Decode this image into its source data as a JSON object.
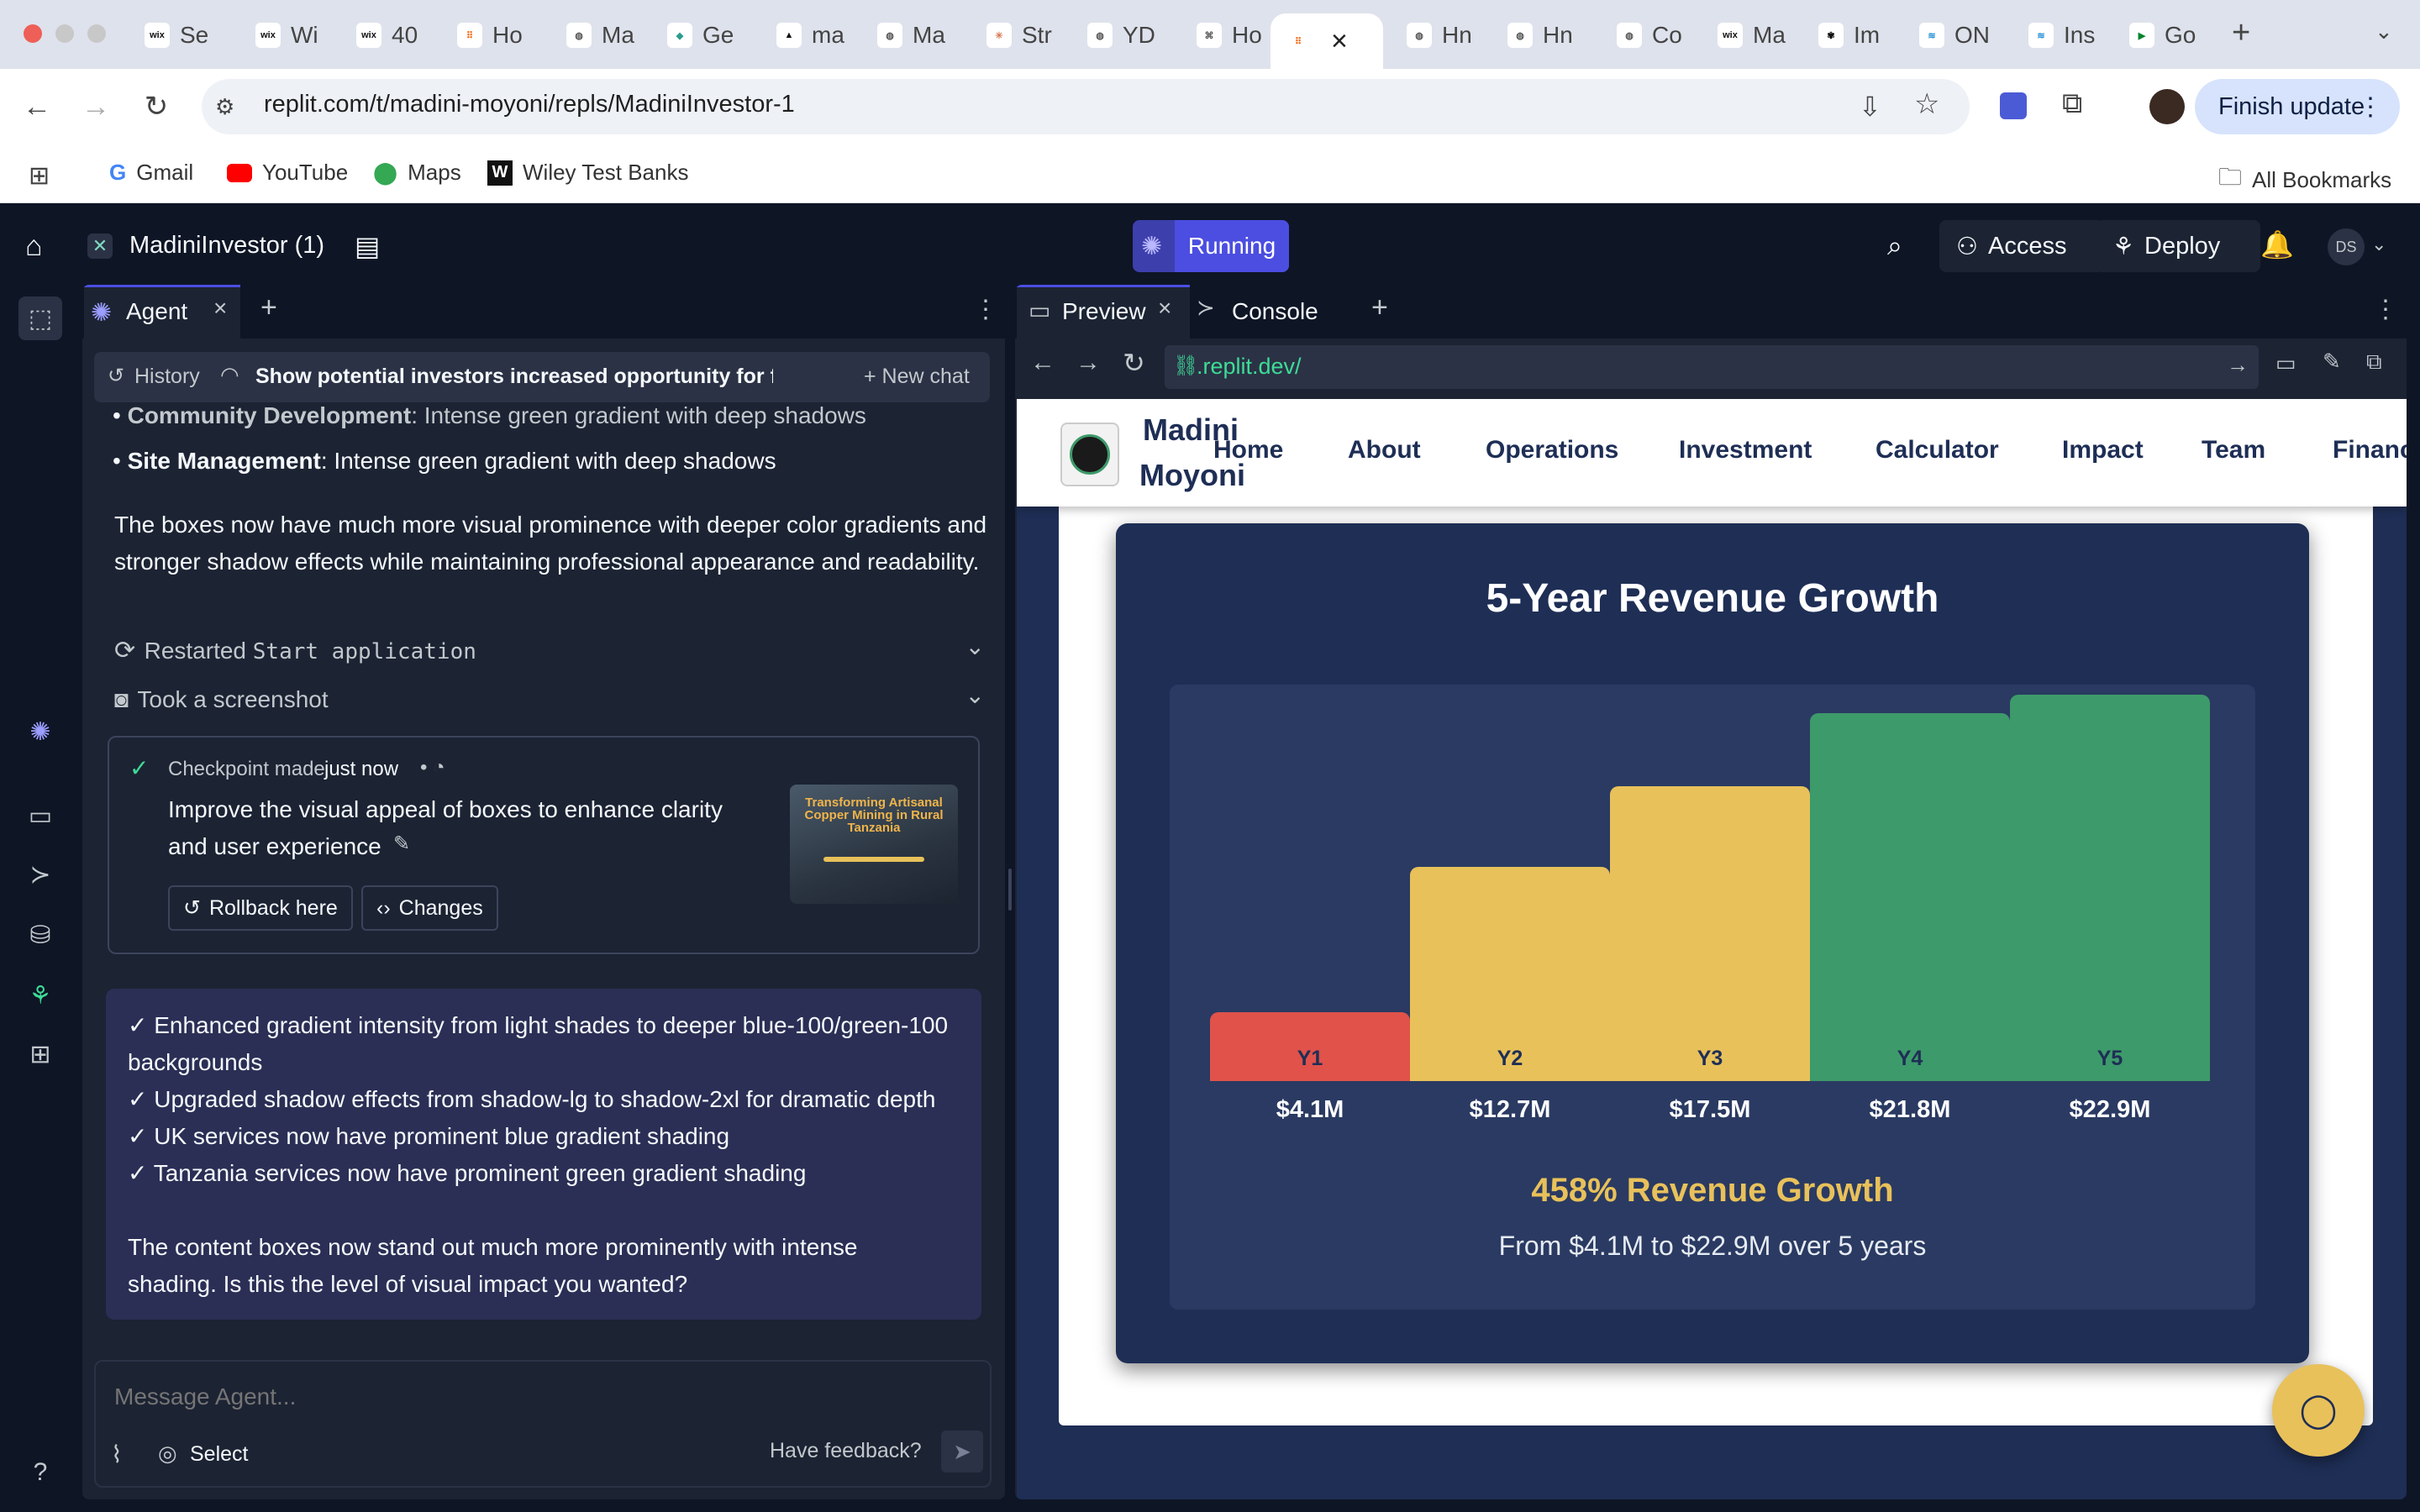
{
  "browser": {
    "tabs": [
      {
        "favicon": "wix",
        "label": "Se"
      },
      {
        "favicon": "wix",
        "label": "Wi"
      },
      {
        "favicon": "wix",
        "label": "40"
      },
      {
        "favicon": "replit",
        "label": "Ho"
      },
      {
        "favicon": "globe",
        "label": "Ma"
      },
      {
        "favicon": "diamond",
        "label": "Ge"
      },
      {
        "favicon": "triangle",
        "label": "ma"
      },
      {
        "favicon": "globe",
        "label": "Ma"
      },
      {
        "favicon": "asterisk",
        "label": "Str"
      },
      {
        "favicon": "globe",
        "label": "YD"
      },
      {
        "favicon": "network",
        "label": "Ho"
      },
      {
        "favicon": "replit",
        "label": ""
      },
      {
        "favicon": "globe",
        "label": "Hn"
      },
      {
        "favicon": "globe",
        "label": "Hn"
      },
      {
        "favicon": "globe",
        "label": "Co"
      },
      {
        "favicon": "wix",
        "label": "Ma"
      },
      {
        "favicon": "openai",
        "label": "Im"
      },
      {
        "favicon": "stack",
        "label": "ON"
      },
      {
        "favicon": "stack",
        "label": "Ins"
      },
      {
        "favicon": "meet",
        "label": "Go"
      }
    ],
    "url": "replit.com/t/madini-moyoni/repls/MadiniInvestor-1",
    "finish_update": "Finish update",
    "bookmarks": [
      "Gmail",
      "YouTube",
      "Maps",
      "Wiley Test Banks"
    ],
    "all_bookmarks": "All Bookmarks"
  },
  "replit": {
    "project_name": "MadiniInvestor (1)",
    "status": "Running",
    "access": "Access",
    "deploy": "Deploy",
    "avatar": "DS"
  },
  "agent": {
    "tab_label": "Agent",
    "history": "History",
    "thread_title": "Show potential investors increased opportunity for financial g...",
    "new_chat": "New chat",
    "bullets": [
      {
        "bold": "Community Development",
        "rest": ": Intense green gradient with deep shadows"
      },
      {
        "bold": "Site Management",
        "rest": ": Intense green gradient with deep shadows"
      }
    ],
    "paragraph": "The boxes now have much more visual prominence with deeper color gradients and stronger shadow effects while maintaining professional appearance and readability.",
    "action1_prefix": "Restarted ",
    "action1_code": "Start application",
    "action2": "Took a screenshot",
    "checkpoint_prefix": "Checkpoint made",
    "checkpoint_time": "just now",
    "checkpoint_desc": "Improve the visual appeal of boxes to enhance clarity and user experience",
    "rollback": "Rollback here",
    "changes": "Changes",
    "thumb_title": "Transforming Artisanal Copper Mining in Rural Tanzania",
    "summary_lines": [
      "✓ Enhanced gradient intensity from light shades to deeper blue-100/green-100 backgrounds",
      "✓ Upgraded shadow effects from shadow-lg to shadow-2xl for dramatic depth",
      "✓ UK services now have prominent blue gradient shading",
      "✓ Tanzania services now have prominent green gradient shading"
    ],
    "summary_close": "The content boxes now stand out much more prominently with intense shading. Is this the level of visual impact you wanted?",
    "message_placeholder": "Message Agent...",
    "select": "Select",
    "feedback": "Have feedback?"
  },
  "preview": {
    "tab_preview": "Preview",
    "tab_console": "Console",
    "url": ".replit.dev/",
    "site": {
      "brand_line1": "Madini",
      "brand_line2": "Moyoni",
      "nav": [
        "Home",
        "About",
        "Operations",
        "Investment",
        "Calculator",
        "Impact",
        "Team",
        "Financ"
      ]
    }
  },
  "chart_data": {
    "type": "bar",
    "title": "5-Year Revenue Growth",
    "categories": [
      "Y1",
      "Y2",
      "Y3",
      "Y4",
      "Y5"
    ],
    "values": [
      4.1,
      12.7,
      17.5,
      21.8,
      22.9
    ],
    "value_labels": [
      "$4.1M",
      "$12.7M",
      "$17.5M",
      "$21.8M",
      "$22.9M"
    ],
    "colors": [
      "#e0524a",
      "#e8c15a",
      "#e8c15a",
      "#3d9a6a",
      "#3d9a6a"
    ],
    "ylim": [
      0,
      23.5
    ],
    "grid": false,
    "headline": "458% Revenue Growth",
    "subline": "From $4.1M to $22.9M over 5 years"
  }
}
